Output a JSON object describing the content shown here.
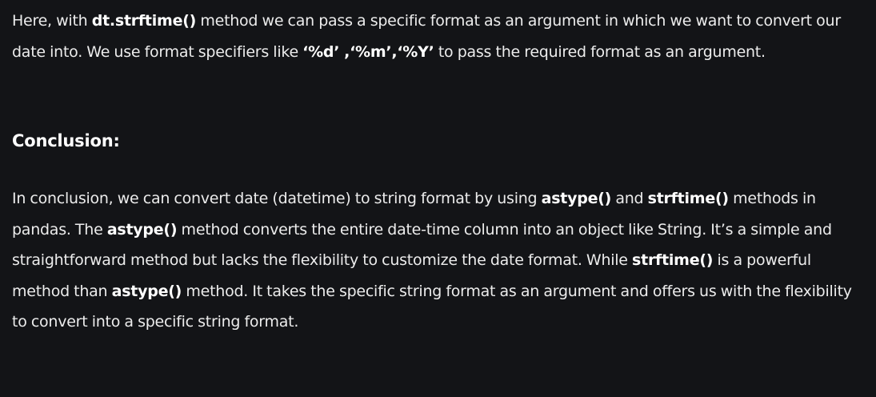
{
  "intro_paragraph": {
    "t1": "Here, with ",
    "b1": "dt.strftime()",
    "t2": " method we can pass a specific format as an argument in which we want to convert our date into. We use format specifiers like ",
    "b2": "‘%d’ ,‘%m’,‘%Y’",
    "t3": " to pass the required format as an argument."
  },
  "conclusion": {
    "heading": "Conclusion:",
    "t1": "In conclusion, we can convert date (datetime) to string format by using ",
    "b1": "astype()",
    "t2": " and ",
    "b2": "strftime()",
    "t3": " methods in pandas. The ",
    "b3": "astype()",
    "t4": " method converts the entire date-time column into an object like String. It’s a simple and straightforward method but lacks the flexibility to customize the date format. While ",
    "b4": "strftime()",
    "t5": " is a powerful method than ",
    "b5": "astype()",
    "t6": " method. It takes the specific string format as an argument and offers us with the flexibility to convert into a specific string format."
  }
}
